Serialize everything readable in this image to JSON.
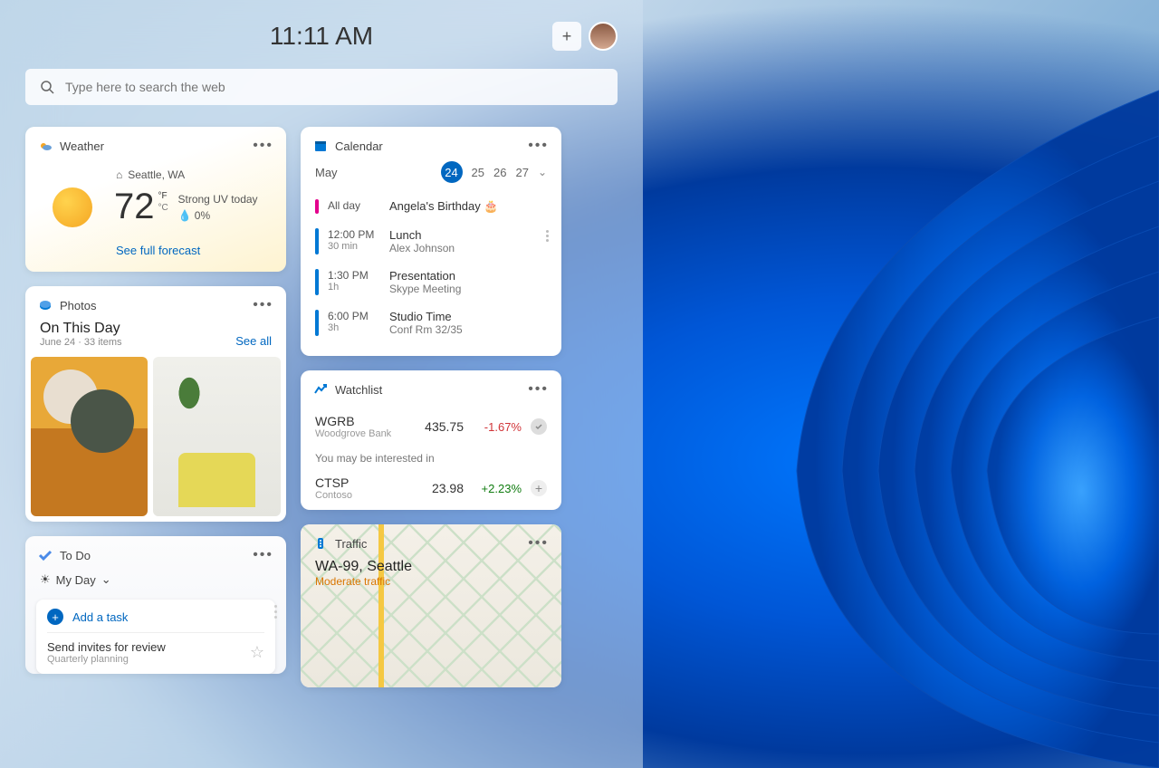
{
  "header": {
    "time": "11:11 AM"
  },
  "search": {
    "placeholder": "Type here to search the web"
  },
  "weather": {
    "title": "Weather",
    "location": "Seattle, WA",
    "temp": "72",
    "unit_f": "°F",
    "unit_c": "°C",
    "condition": "Strong UV today",
    "precip": "💧 0%",
    "link": "See full forecast"
  },
  "calendar": {
    "title": "Calendar",
    "month": "May",
    "days": [
      "24",
      "25",
      "26",
      "27"
    ],
    "selected": "24",
    "events": [
      {
        "time": "All day",
        "dur": "",
        "title": "Angela's Birthday 🎂",
        "sub": "",
        "color": "pink"
      },
      {
        "time": "12:00 PM",
        "dur": "30 min",
        "title": "Lunch",
        "sub": "Alex Johnson",
        "color": "blue"
      },
      {
        "time": "1:30 PM",
        "dur": "1h",
        "title": "Presentation",
        "sub": "Skype Meeting",
        "color": "blue"
      },
      {
        "time": "6:00 PM",
        "dur": "3h",
        "title": "Studio Time",
        "sub": "Conf Rm 32/35",
        "color": "blue"
      }
    ]
  },
  "photos": {
    "title": "Photos",
    "heading": "On This Day",
    "sub": "June 24 · 33 items",
    "see_all": "See all"
  },
  "watchlist": {
    "title": "Watchlist",
    "rows": [
      {
        "sym": "WGRB",
        "co": "Woodgrove Bank",
        "price": "435.75",
        "chg": "-1.67%",
        "dir": "neg"
      },
      {
        "sym": "CTSP",
        "co": "Contoso",
        "price": "23.98",
        "chg": "+2.23%",
        "dir": "pos"
      }
    ],
    "interest": "You may be interested in"
  },
  "todo": {
    "title": "To Do",
    "myday": "My Day",
    "add": "Add a task",
    "task_title": "Send invites for review",
    "task_sub": "Quarterly planning"
  },
  "traffic": {
    "title": "Traffic",
    "route": "WA-99, Seattle",
    "status": "Moderate traffic"
  }
}
